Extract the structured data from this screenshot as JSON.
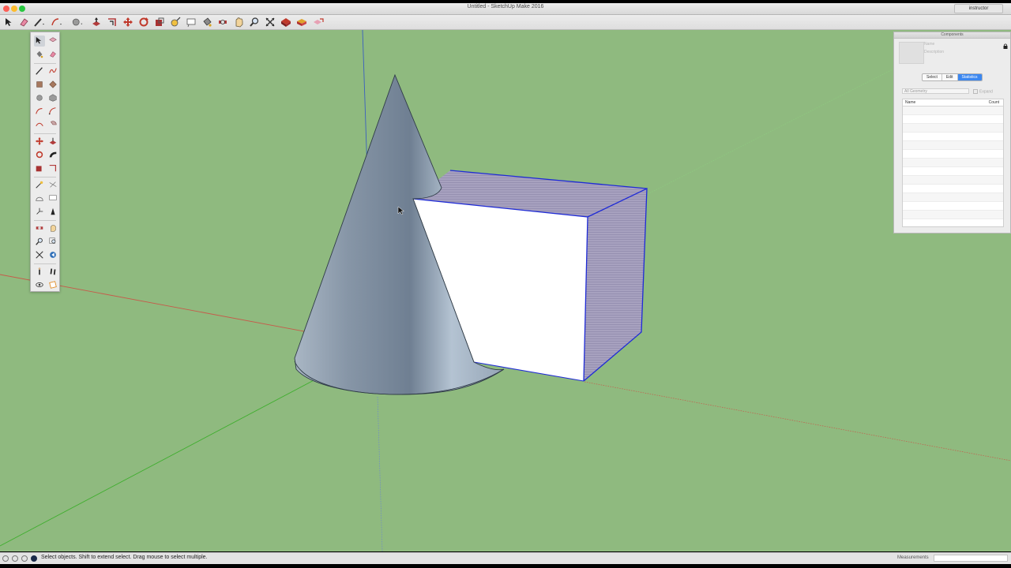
{
  "window": {
    "title": "Untitled - SketchUp Make 2016",
    "user": "instructor"
  },
  "toolbar": {
    "items": [
      {
        "name": "select-tool-button",
        "icon": "arrow-cursor-icon"
      },
      {
        "name": "eraser-tool-button",
        "icon": "eraser-icon"
      },
      {
        "name": "line-tool-button",
        "icon": "pencil-icon"
      },
      {
        "name": "arc-tool-button",
        "icon": "arc-icon"
      },
      {
        "name": "shapes-tool-button",
        "icon": "circle-icon"
      },
      {
        "name": "push-pull-tool-button",
        "icon": "push-pull-icon"
      },
      {
        "name": "offset-tool-button",
        "icon": "offset-icon"
      },
      {
        "name": "move-tool-button",
        "icon": "move-icon"
      },
      {
        "name": "rotate-tool-button",
        "icon": "rotate-icon"
      },
      {
        "name": "scale-tool-button",
        "icon": "scale-icon"
      },
      {
        "name": "tape-measure-tool-button",
        "icon": "tape-measure-icon"
      },
      {
        "name": "text-tool-button",
        "icon": "text-icon"
      },
      {
        "name": "paint-bucket-tool-button",
        "icon": "paint-bucket-icon"
      },
      {
        "name": "orbit-tool-button",
        "icon": "orbit-icon"
      },
      {
        "name": "pan-tool-button",
        "icon": "pan-icon"
      },
      {
        "name": "zoom-tool-button",
        "icon": "zoom-icon"
      },
      {
        "name": "zoom-extents-tool-button",
        "icon": "zoom-extents-icon"
      },
      {
        "name": "warehouse-button",
        "icon": "warehouse-icon"
      },
      {
        "name": "extension-warehouse-button",
        "icon": "extension-warehouse-icon"
      },
      {
        "name": "share-model-button",
        "icon": "share-model-icon"
      }
    ]
  },
  "palette": {
    "tools": [
      "select-icon",
      "component-icon",
      "paint-bucket-icon",
      "eraser-icon",
      "line-icon",
      "freehand-icon",
      "rectangle-icon",
      "rotated-rectangle-icon",
      "circle-icon",
      "polygon-icon",
      "arc-icon",
      "two-point-arc-icon",
      "three-point-arc-icon",
      "pie-icon",
      "move-icon",
      "push-pull-icon",
      "rotate-icon",
      "follow-me-icon",
      "scale-icon",
      "offset-icon",
      "tape-measure-icon",
      "dimension-icon",
      "protractor-icon",
      "text-icon",
      "axes-icon",
      "3d-text-icon",
      "orbit-icon",
      "pan-icon",
      "zoom-icon",
      "zoom-window-icon",
      "zoom-extents-icon",
      "previous-view-icon",
      "position-camera-icon",
      "walk-icon",
      "look-around-icon",
      "section-plane-icon"
    ]
  },
  "components_panel": {
    "title": "Components",
    "name_placeholder": "Name",
    "description_placeholder": "Description",
    "tabs": [
      "Select",
      "Edit",
      "Statistics"
    ],
    "active_tab": "Statistics",
    "filter": "All Geometry",
    "expand_label": "Expand",
    "columns": [
      "Name",
      "Count"
    ],
    "rows": []
  },
  "status": {
    "message": "Select objects. Shift to extend select. Drag mouse to select multiple.",
    "measurements_label": "Measurements",
    "measurements_value": ""
  },
  "colors": {
    "ground": "#8fba7f",
    "selection": "#1f2bd6",
    "axis_red": "#c75a4a",
    "axis_green": "#3fae2e",
    "axis_blue": "#3b5fbf",
    "accent": "#3b87f0"
  }
}
